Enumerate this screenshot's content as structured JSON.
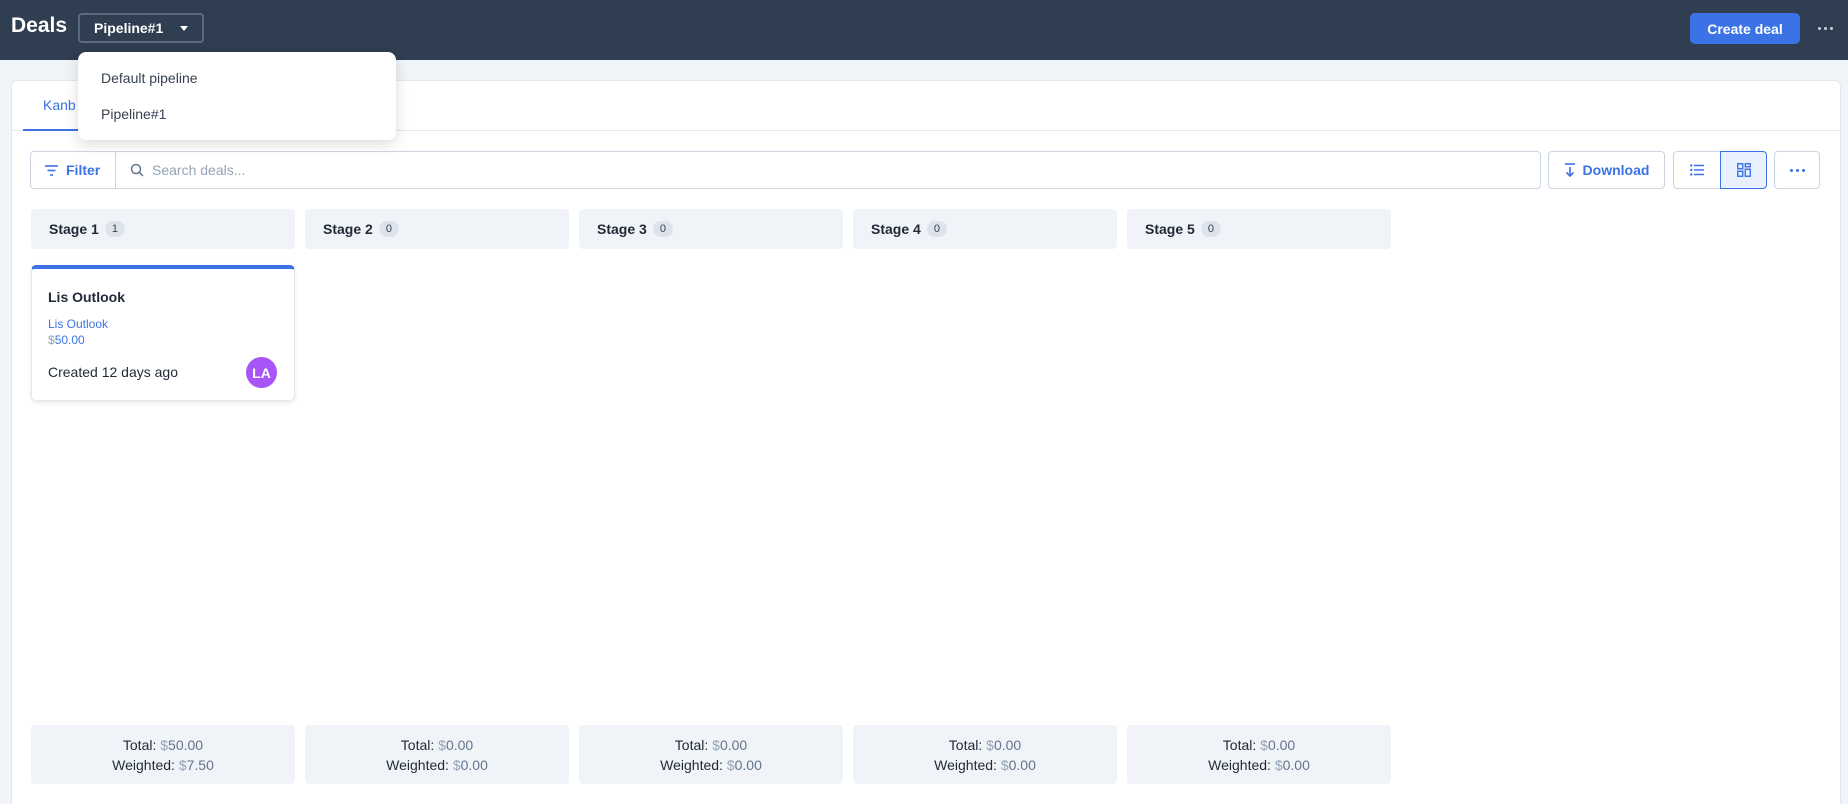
{
  "header": {
    "title": "Deals",
    "pipeline_selected": "Pipeline#1",
    "create_label": "Create deal",
    "more_icon": "more-dots-icon"
  },
  "pipeline_dropdown": {
    "options": [
      "Default pipeline",
      "Pipeline#1"
    ]
  },
  "tabs": [
    {
      "label": "Kanb",
      "active": true
    }
  ],
  "toolbar": {
    "filter_label": "Filter",
    "search_placeholder": "Search deals...",
    "search_value": "",
    "download_label": "Download",
    "active_view": "kanban"
  },
  "stages": [
    {
      "name": "Stage 1",
      "count": "1",
      "total_label": "Total:",
      "total_currency": "$",
      "total_value": "50.00",
      "weighted_label": "Weighted:",
      "weighted_currency": "$",
      "weighted_value": "7.50"
    },
    {
      "name": "Stage 2",
      "count": "0",
      "total_label": "Total:",
      "total_currency": "$",
      "total_value": "0.00",
      "weighted_label": "Weighted:",
      "weighted_currency": "$",
      "weighted_value": "0.00"
    },
    {
      "name": "Stage 3",
      "count": "0",
      "total_label": "Total:",
      "total_currency": "$",
      "total_value": "0.00",
      "weighted_label": "Weighted:",
      "weighted_currency": "$",
      "weighted_value": "0.00"
    },
    {
      "name": "Stage 4",
      "count": "0",
      "total_label": "Total:",
      "total_currency": "$",
      "total_value": "0.00",
      "weighted_label": "Weighted:",
      "weighted_currency": "$",
      "weighted_value": "0.00"
    },
    {
      "name": "Stage 5",
      "count": "0",
      "total_label": "Total:",
      "total_currency": "$",
      "total_value": "0.00",
      "weighted_label": "Weighted:",
      "weighted_currency": "$",
      "weighted_value": "0.00"
    }
  ],
  "deal": {
    "title": "Lis Outlook",
    "organization": "Lis Outlook",
    "currency": "$",
    "amount": "50.00",
    "created": "Created 12 days ago",
    "avatar_initials": "LA",
    "avatar_color": "#a855f7"
  },
  "colors": {
    "accent": "#3b73e6",
    "topbar": "#2f3e50"
  }
}
